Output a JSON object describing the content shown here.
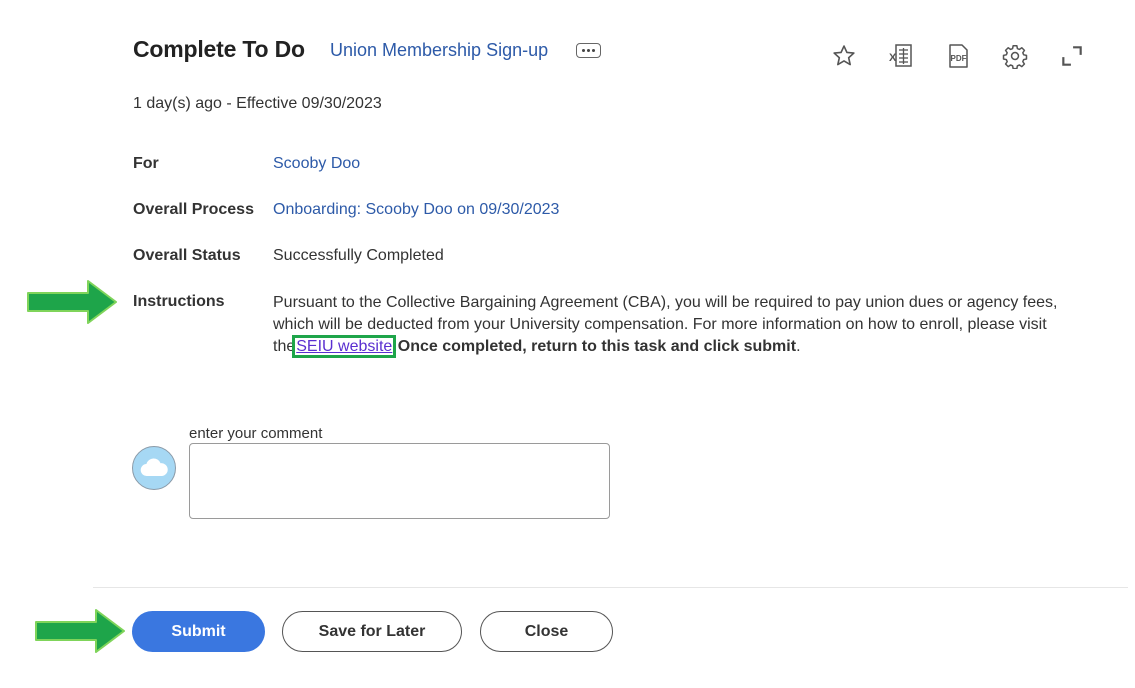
{
  "header": {
    "title": "Complete To Do",
    "subtitle_link": "Union Membership Sign-up",
    "related_actions_icon": "more-horizontal-icon",
    "toolbar": [
      {
        "name": "star-icon",
        "label": "Favorite"
      },
      {
        "name": "excel-export-icon",
        "label": "Export to Excel"
      },
      {
        "name": "pdf-export-icon",
        "label": "Export to PDF"
      },
      {
        "name": "gear-icon",
        "label": "Settings"
      },
      {
        "name": "expand-icon",
        "label": "Expand"
      }
    ]
  },
  "meta": {
    "text": "1 day(s) ago -  Effective 09/30/2023"
  },
  "fields": {
    "for": {
      "label": "For",
      "value": "Scooby Doo"
    },
    "overall_process": {
      "label": "Overall Process",
      "value": "Onboarding: Scooby Doo on 09/30/2023"
    },
    "overall_status": {
      "label": "Overall Status",
      "value": "Successfully Completed"
    },
    "instructions": {
      "label": "Instructions",
      "text_before": "Pursuant to the Collective Bargaining Agreement (CBA), you will be required to pay union dues or agency fees, which will be deducted from your University compensation. For more information on how to enroll, please visit the",
      "link_text": "SEIU website",
      "bold_text": " Once completed, return to this task and click submit",
      "text_after": "."
    }
  },
  "comment": {
    "label": "enter your comment",
    "value": "",
    "avatar_icon": "cloud-icon"
  },
  "buttons": {
    "submit": "Submit",
    "save_for_later": "Save for Later",
    "close": "Close"
  },
  "colors": {
    "link": "#2d5aa8",
    "primary_button": "#3a77e0",
    "highlight_arrow": "#1ea54a",
    "avatar_bg": "#a6d8f4"
  }
}
